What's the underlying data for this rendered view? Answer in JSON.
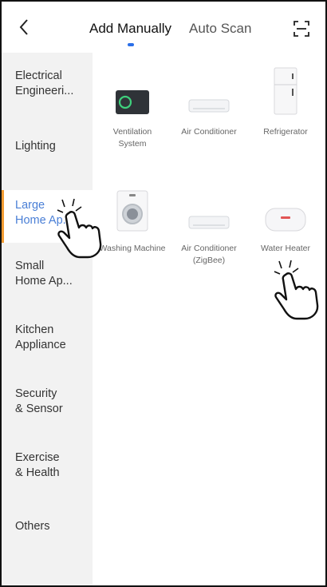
{
  "header": {
    "tabs": [
      {
        "label": "Add Manually",
        "active": true
      },
      {
        "label": "Auto Scan",
        "active": false
      }
    ]
  },
  "sidebar": {
    "items": [
      {
        "label": "Electrical\nEngineeri..."
      },
      {
        "label": "Lighting"
      },
      {
        "label": "Large\nHome Ap..."
      },
      {
        "label": "Small\nHome Ap..."
      },
      {
        "label": "Kitchen\nAppliance"
      },
      {
        "label": "Security\n& Sensor"
      },
      {
        "label": "Exercise\n& Health"
      },
      {
        "label": "Others"
      }
    ],
    "selected_index": 2
  },
  "devices": [
    {
      "name": "Ventilation\nSystem",
      "icon": "ventilation-system-icon"
    },
    {
      "name": "Air Conditioner",
      "icon": "air-conditioner-icon"
    },
    {
      "name": "Refrigerator",
      "icon": "refrigerator-icon"
    },
    {
      "name": "Washing Machine",
      "icon": "washing-machine-icon"
    },
    {
      "name": "Air Conditioner\n(ZigBee)",
      "icon": "air-conditioner-zigbee-icon"
    },
    {
      "name": "Water Heater",
      "icon": "water-heater-icon"
    }
  ],
  "colors": {
    "accent": "#2b6fe8",
    "selected_text": "#4a7fd6",
    "selected_marker": "#f39c33",
    "sidebar_bg": "#f2f2f2"
  }
}
